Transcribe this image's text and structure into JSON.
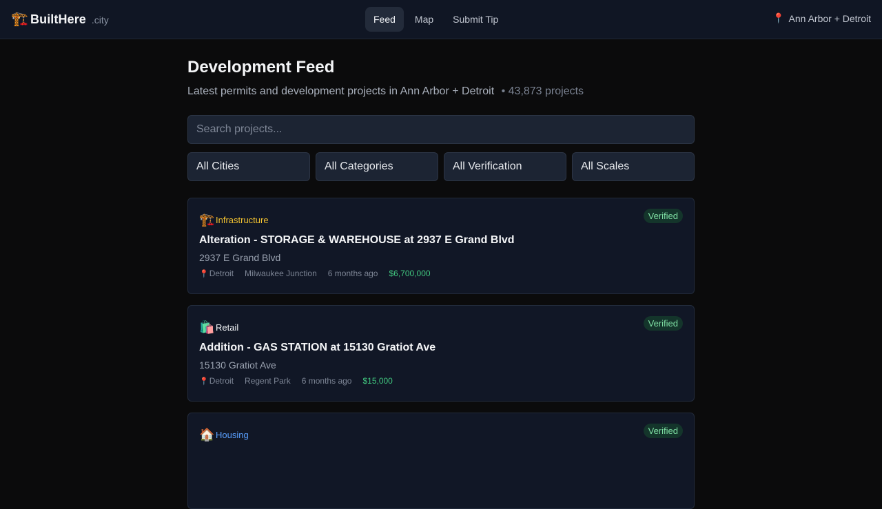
{
  "brand": {
    "name": "BuiltHere",
    "tld": ".city",
    "logo_icon": "🏗️"
  },
  "nav": {
    "tabs": [
      {
        "label": "Feed"
      },
      {
        "label": "Map"
      },
      {
        "label": "Submit Tip"
      }
    ],
    "active": "Feed"
  },
  "location": {
    "icon": "📍",
    "label": "Ann Arbor + Detroit"
  },
  "page": {
    "title": "Development Feed",
    "subtitle": "Latest permits and development projects in Ann Arbor + Detroit",
    "count": "• 43,873 projects"
  },
  "search": {
    "placeholder": "Search projects...",
    "value": ""
  },
  "filters": [
    "All Cities",
    "All Categories",
    "All Verification",
    "All Scales"
  ],
  "colors": {
    "infrastructure": "#f2c230",
    "retail": "#f2f4f7",
    "housing": "#5aa0ff",
    "verified_text": "#7fe0a4",
    "price": "#41c77f"
  },
  "projects": [
    {
      "category": "Infrastructure",
      "category_icon": "🏗️",
      "badge": "Verified",
      "title": "Alteration - STORAGE & WAREHOUSE at 2937 E Grand Blvd",
      "address": "2937 E Grand Blvd",
      "city_icon": "📍",
      "city": "Detroit",
      "neighborhood": "Milwaukee Junction",
      "time": "6 months ago",
      "price": "$6,700,000"
    },
    {
      "category": "Retail",
      "category_icon": "🛍️",
      "badge": "Verified",
      "title": "Addition - GAS STATION at 15130 Gratiot Ave",
      "address": "15130 Gratiot Ave",
      "city_icon": "📍",
      "city": "Detroit",
      "neighborhood": "Regent Park",
      "time": "6 months ago",
      "price": "$15,000"
    },
    {
      "category": "Housing",
      "category_icon": "🏠",
      "badge": "Verified"
    }
  ]
}
